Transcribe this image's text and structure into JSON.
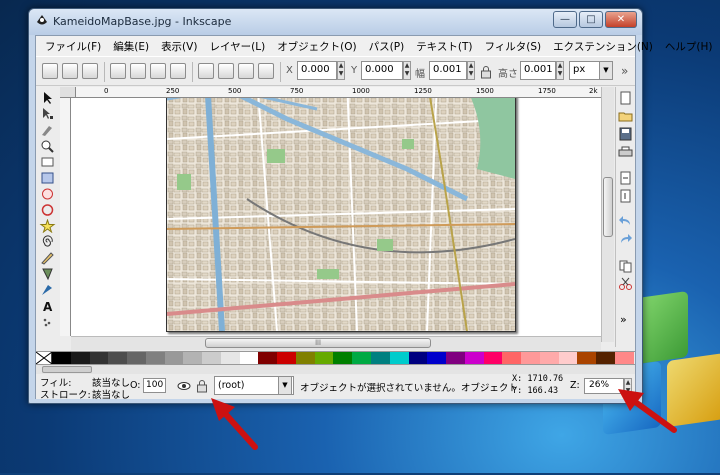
{
  "window": {
    "title": "KameidoMapBase.jpg - Inkscape",
    "min_glyph": "—",
    "max_glyph": "□",
    "close_glyph": "✕"
  },
  "menu": [
    "ファイル(F)",
    "編集(E)",
    "表示(V)",
    "レイヤー(L)",
    "オブジェクト(O)",
    "パス(P)",
    "テキスト(T)",
    "フィルタ(S)",
    "エクステンション(N)",
    "ヘルプ(H)"
  ],
  "toolbar": {
    "x_label": "X",
    "x_value": "0.000",
    "y_label": "Y",
    "y_value": "0.000",
    "w_label": "幅",
    "w_value": "0.001",
    "h_label": "高さ",
    "h_value": "0.001",
    "unit": "px",
    "overflow": "»"
  },
  "ruler": {
    "top_ticks": [
      "0",
      "250",
      "500",
      "750",
      "1000",
      "1250",
      "1500",
      "1750",
      "2k"
    ]
  },
  "hscroll_grip": "lll",
  "palette": [
    "#000000",
    "#1a1a1a",
    "#333333",
    "#4d4d4d",
    "#666666",
    "#808080",
    "#999999",
    "#b3b3b3",
    "#cccccc",
    "#e6e6e6",
    "#ffffff",
    "#800000",
    "#cc0000",
    "#808000",
    "#66aa00",
    "#008000",
    "#00aa44",
    "#008080",
    "#00cccc",
    "#000080",
    "#0000cc",
    "#800080",
    "#cc00cc",
    "#ff0066",
    "#ff6666",
    "#ff9999",
    "#ffaaaa",
    "#ffcccc",
    "#aa4400",
    "#552200",
    "#ff8888"
  ],
  "status": {
    "fill_label": "フィル:",
    "fill_value": "該当なし",
    "stroke_label": "ストローク:",
    "stroke_value": "該当なし",
    "opacity_label": "O:",
    "opacity_value": "100",
    "layer": "(root)",
    "message": "オブジェクトが選択されていません。オブジェクト",
    "x_coord": "X: 1710.76",
    "y_coord": "Y:  166.43",
    "zoom_label": "Z:",
    "zoom_value": "26%"
  },
  "colors": {
    "annotation_arrow": "#cc1111",
    "desktop": "#1a62b0"
  }
}
